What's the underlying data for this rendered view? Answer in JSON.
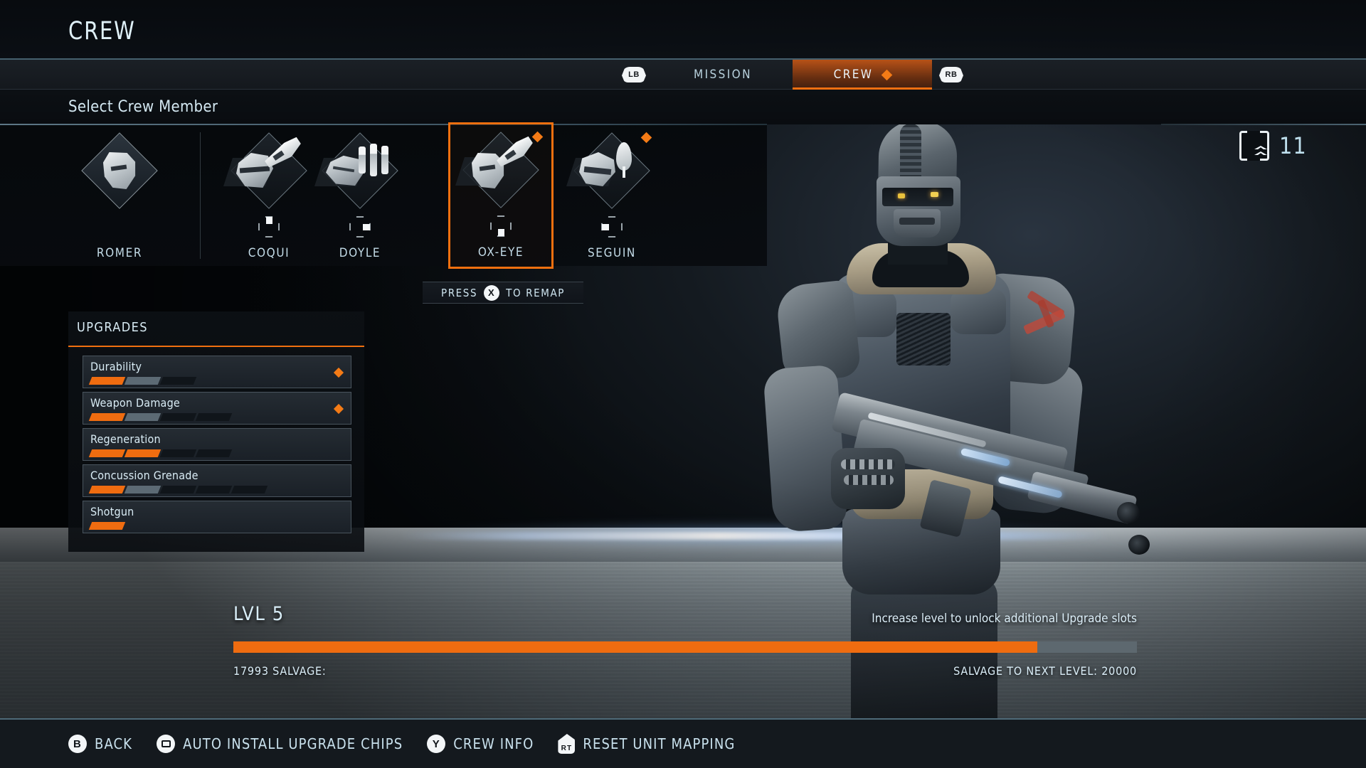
{
  "header": {
    "title": "CREW"
  },
  "tabs": {
    "left_bumper": "LB",
    "right_bumper": "RB",
    "items": [
      {
        "label": "MISSION",
        "active": false,
        "badge": false
      },
      {
        "label": "CREW",
        "active": true,
        "badge": true
      }
    ]
  },
  "subheader": {
    "label": "Select Crew Member"
  },
  "level_badge": {
    "icon": "double-chevron-up-icon",
    "value": "11"
  },
  "crew": {
    "members": [
      {
        "name": "ROMER",
        "dpad": "none",
        "badge": false,
        "selected": false,
        "icons": [
          "helmet"
        ]
      },
      {
        "name": "COQUI",
        "dpad": "up",
        "badge": false,
        "selected": false,
        "icons": [
          "bandit-head",
          "weapon"
        ]
      },
      {
        "name": "DOYLE",
        "dpad": "right",
        "badge": false,
        "selected": false,
        "icons": [
          "stone-head",
          "vials"
        ]
      },
      {
        "name": "OX-EYE",
        "dpad": "down",
        "badge": true,
        "selected": true,
        "icons": [
          "helmet-head",
          "weapon"
        ]
      },
      {
        "name": "SEGUIN",
        "dpad": "left",
        "badge": true,
        "selected": false,
        "icons": [
          "mask-head",
          "dart"
        ]
      }
    ]
  },
  "remap_prompt": {
    "before": "PRESS",
    "button": "X",
    "after": "TO REMAP"
  },
  "upgrades": {
    "title": "UPGRADES",
    "rows": [
      {
        "name": "Durability",
        "pips": [
          "on",
          "mid",
          "off"
        ],
        "badge": true
      },
      {
        "name": "Weapon Damage",
        "pips": [
          "on",
          "mid",
          "off",
          "off"
        ],
        "badge": true
      },
      {
        "name": "Regeneration",
        "pips": [
          "on",
          "on",
          "off",
          "off"
        ],
        "badge": false
      },
      {
        "name": "Concussion Grenade",
        "pips": [
          "on",
          "mid",
          "off",
          "off",
          "off"
        ],
        "badge": false
      },
      {
        "name": "Shotgun",
        "pips": [
          "on"
        ],
        "badge": false
      }
    ]
  },
  "progress": {
    "level_label": "LVL 5",
    "hint": "Increase level to unlock additional Upgrade slots",
    "salvage_current": "17993 SALVAGE:",
    "salvage_next": "SALVAGE TO NEXT LEVEL: 20000",
    "fill_percent": 89
  },
  "footer": {
    "actions": [
      {
        "glyph": "B",
        "glyph_type": "circle",
        "label": "BACK"
      },
      {
        "glyph": "",
        "glyph_type": "view",
        "label": "AUTO INSTALL UPGRADE CHIPS"
      },
      {
        "glyph": "Y",
        "glyph_type": "circle",
        "label": "CREW INFO"
      },
      {
        "glyph": "RT",
        "glyph_type": "trigger",
        "label": "RESET UNIT MAPPING"
      }
    ]
  },
  "colors": {
    "accent": "#f1700f",
    "text": "#cfe3ec",
    "pip_on": "#ef6c10",
    "pip_mid": "#5c6a74"
  }
}
